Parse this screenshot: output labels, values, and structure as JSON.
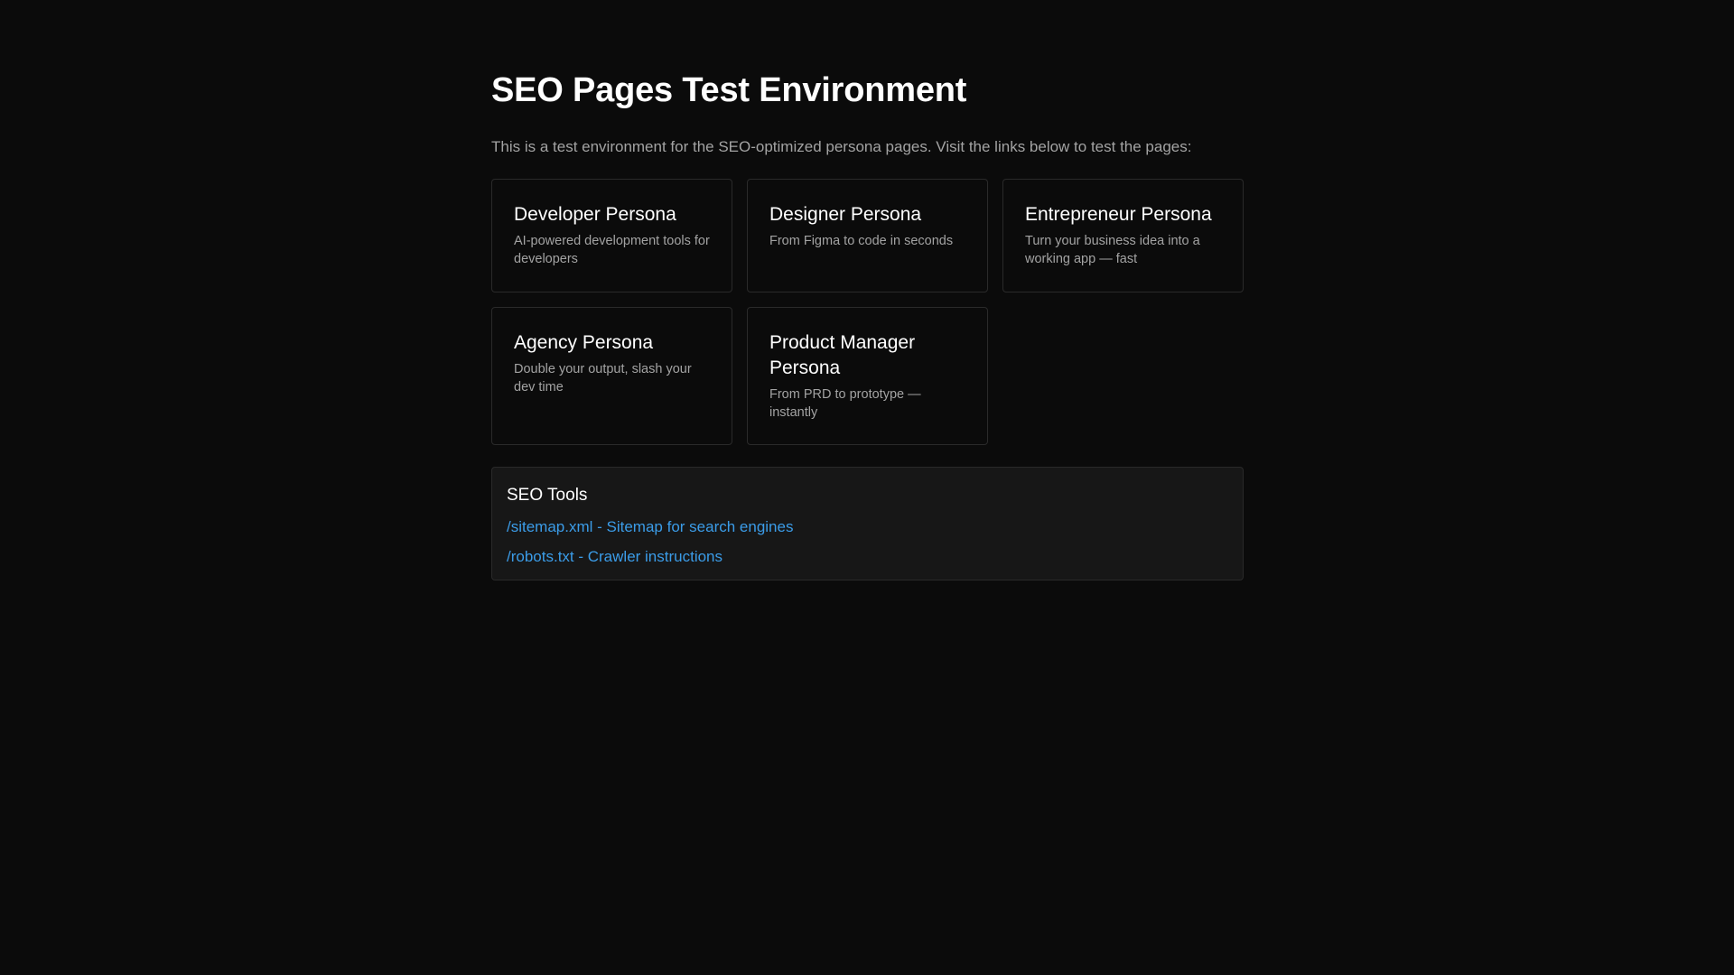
{
  "header": {
    "title": "SEO Pages Test Environment",
    "intro": "This is a test environment for the SEO-optimized persona pages. Visit the links below to test the pages:"
  },
  "personas": [
    {
      "title": "Developer Persona",
      "description": "AI-powered development tools for developers"
    },
    {
      "title": "Designer Persona",
      "description": "From Figma to code in seconds"
    },
    {
      "title": "Entrepreneur Persona",
      "description": "Turn your business idea into a working app — fast"
    },
    {
      "title": "Agency Persona",
      "description": "Double your output, slash your dev time"
    },
    {
      "title": "Product Manager Persona",
      "description": "From PRD to prototype — instantly"
    }
  ],
  "seo_tools": {
    "title": "SEO Tools",
    "links": [
      {
        "label": "/sitemap.xml - Sitemap for search engines"
      },
      {
        "label": "/robots.txt - Crawler instructions"
      }
    ]
  },
  "colors": {
    "background": "#0b0b0b",
    "card_border": "#2a2a2a",
    "panel_background": "#171717",
    "muted_text": "#a3a3a3",
    "link": "#3b9ce8"
  }
}
